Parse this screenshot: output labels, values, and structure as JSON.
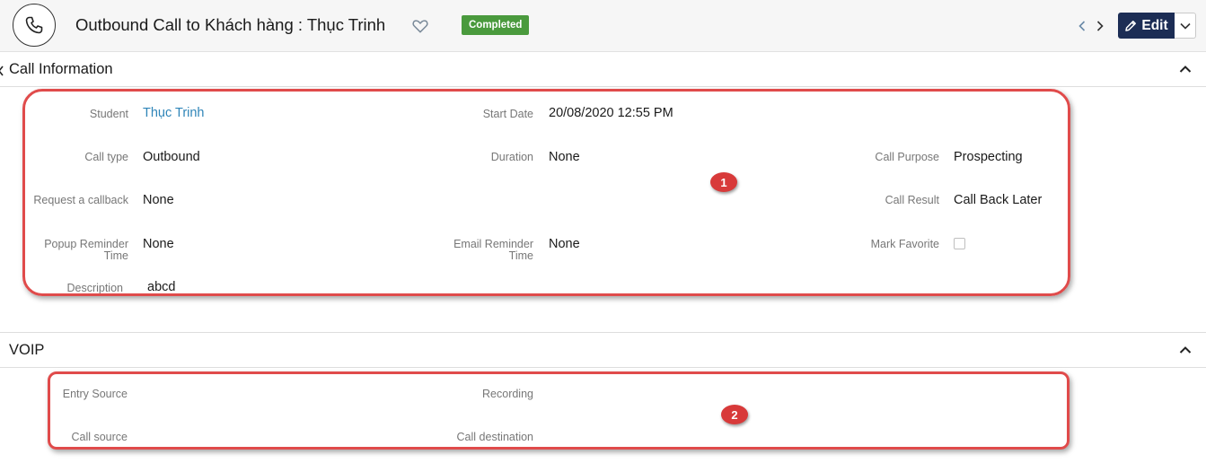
{
  "header": {
    "title": "Outbound Call to Khách hàng : Thục Trinh",
    "status_badge": "Completed",
    "edit_label": "Edit",
    "prev_label": "‹",
    "next_label": "›"
  },
  "call_info": {
    "section_title": "Call Information",
    "student_label": "Student",
    "student_value": "Thục Trinh",
    "start_date_label": "Start Date",
    "start_date_value": "20/08/2020 12:55 PM",
    "call_type_label": "Call type",
    "call_type_value": "Outbound",
    "duration_label": "Duration",
    "duration_value": "None",
    "call_purpose_label": "Call Purpose",
    "call_purpose_value": "Prospecting",
    "request_callback_label": "Request a callback",
    "request_callback_value": "None",
    "call_result_label": "Call Result",
    "call_result_value": "Call Back Later",
    "popup_reminder_label_1": "Popup Reminder",
    "popup_reminder_label_2": "Time",
    "popup_reminder_value": "None",
    "email_reminder_label_1": "Email Reminder",
    "email_reminder_label_2": "Time",
    "email_reminder_value": "None",
    "mark_favorite_label": "Mark Favorite",
    "description_label": "Description",
    "description_value": "abcd"
  },
  "voip": {
    "section_title": "VOIP",
    "entry_source_label": "Entry Source",
    "recording_label": "Recording",
    "call_source_label": "Call source",
    "call_destination_label": "Call destination"
  },
  "annotations": {
    "marker_1": "1",
    "marker_2": "2"
  },
  "colors": {
    "accent_link": "#2f85b8",
    "badge_green": "#4a9a3d",
    "edit_button": "#1c2d55",
    "highlight_red": "#e04b4b"
  }
}
